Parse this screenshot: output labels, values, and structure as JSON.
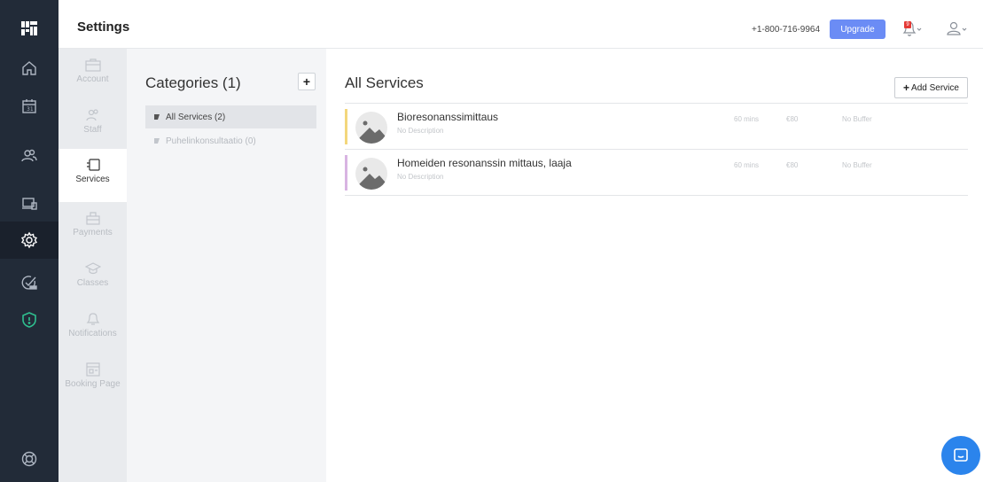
{
  "header": {
    "title": "Settings",
    "phone": "+1-800-716-9964",
    "upgrade_label": "Upgrade",
    "notifications_badge": "9"
  },
  "rail": {
    "items": [
      "home",
      "calendar",
      "customers",
      "devices",
      "settings",
      "tasks",
      "security",
      "support"
    ],
    "active": "settings"
  },
  "subnav": {
    "items": [
      {
        "label": "Account",
        "icon": "briefcase-icon"
      },
      {
        "label": "Staff",
        "icon": "staff-icon"
      },
      {
        "label": "Services",
        "icon": "services-icon"
      },
      {
        "label": "Payments",
        "icon": "payments-icon"
      },
      {
        "label": "Classes",
        "icon": "classes-icon"
      },
      {
        "label": "Notifications",
        "icon": "bell-icon"
      },
      {
        "label": "Booking Page",
        "icon": "booking-page-icon"
      }
    ],
    "active": "Services"
  },
  "categories": {
    "title": "Categories (1)",
    "add_label": "+",
    "items": [
      {
        "label": "All Services (2)"
      },
      {
        "label": "Puhelinkonsultaatio (0)"
      }
    ]
  },
  "services": {
    "title": "All Services",
    "add_label": "Add Service",
    "items": [
      {
        "name": "Bioresonanssimittaus",
        "description": "No Description",
        "duration": "60 mins",
        "price": "€80",
        "buffer": "No Buffer",
        "color": "#f3d77c"
      },
      {
        "name": "Homeiden resonanssin mittaus, laaja",
        "description": "No Description",
        "duration": "60 mins",
        "price": "€80",
        "buffer": "No Buffer",
        "color": "#d8b4e2"
      }
    ]
  },
  "colors": {
    "rail_bg": "#222b38",
    "accent": "#6b8cf5",
    "security_green": "#2fbf8f",
    "chat_blue": "#2b84ec"
  }
}
